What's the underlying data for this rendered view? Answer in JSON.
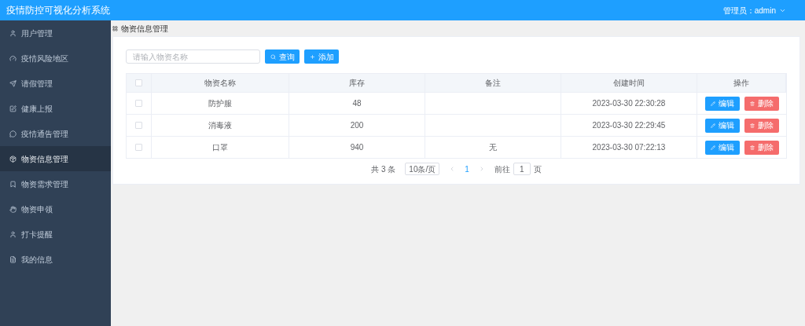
{
  "header": {
    "title": "疫情防控可视化分析系统",
    "user": "管理员：admin"
  },
  "sidebar": {
    "items": [
      {
        "label": "用户管理",
        "selected": false
      },
      {
        "label": "疫情风险地区",
        "selected": false
      },
      {
        "label": "请假管理",
        "selected": false
      },
      {
        "label": "健康上报",
        "selected": false
      },
      {
        "label": "疫情通告管理",
        "selected": false
      },
      {
        "label": "物资信息管理",
        "selected": true
      },
      {
        "label": "物资需求管理",
        "selected": false
      },
      {
        "label": "物资申领",
        "selected": false
      },
      {
        "label": "打卡提醒",
        "selected": false
      },
      {
        "label": "我的信息",
        "selected": false
      }
    ]
  },
  "breadcrumb": "物资信息管理",
  "search": {
    "placeholder": "请输入物资名称"
  },
  "buttons": {
    "search": "查询",
    "add": "添加"
  },
  "table": {
    "select_all_checked": false,
    "columns": [
      "物资名称",
      "库存",
      "备注",
      "创建时间",
      "操作"
    ],
    "rows": [
      {
        "checked": false,
        "name": "防护服",
        "stock": "48",
        "note": "",
        "created": "2023-03-30 22:30:28",
        "edit": "编辑",
        "delete": "删除"
      },
      {
        "checked": false,
        "name": "消毒液",
        "stock": "200",
        "note": "",
        "created": "2023-03-30 22:29:45",
        "edit": "编辑",
        "delete": "删除"
      },
      {
        "checked": false,
        "name": "口罩",
        "stock": "940",
        "note": "无",
        "created": "2023-03-30 07:22:13",
        "edit": "编辑",
        "delete": "删除"
      }
    ]
  },
  "pagination": {
    "total": "共 3 条",
    "page_size": "10条/页",
    "current_page": "1",
    "goto_label": "前往",
    "goto_value": "1",
    "goto_suffix": "页"
  }
}
